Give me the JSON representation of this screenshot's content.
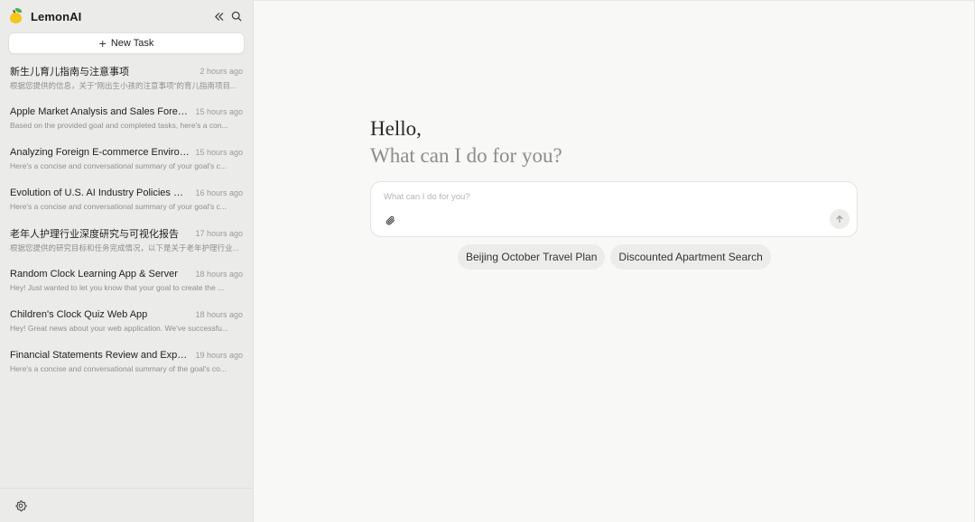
{
  "app": {
    "name": "LemonAI"
  },
  "sidebar": {
    "new_task_label": "New Task",
    "tasks": [
      {
        "title": "新生儿育儿指南与注意事项",
        "time": "2 hours ago",
        "preview": "根据您提供的信息，关于\"刚出生小孩的注意事项\"的育儿指南项目..."
      },
      {
        "title": "Apple Market Analysis and Sales Forecas...",
        "time": "15 hours ago",
        "preview": "Based on the provided goal and completed tasks, here's a con..."
      },
      {
        "title": "Analyzing Foreign E-commerce Environ...",
        "time": "15 hours ago",
        "preview": "Here's a concise and conversational summary of your goal's c..."
      },
      {
        "title": "Evolution of U.S. AI Industry Policies Ove...",
        "time": "16 hours ago",
        "preview": "Here's a concise and conversational summary of your goal's c..."
      },
      {
        "title": "老年人护理行业深度研究与可视化报告",
        "time": "17 hours ago",
        "preview": "根据您提供的研究目标和任务完成情况，以下是关于老年护理行业..."
      },
      {
        "title": "Random Clock Learning App & Server",
        "time": "18 hours ago",
        "preview": "Hey! Just wanted to let you know that your goal to create the ..."
      },
      {
        "title": "Children's Clock Quiz Web App",
        "time": "18 hours ago",
        "preview": "Hey! Great news about your web application. We've successfu..."
      },
      {
        "title": "Financial Statements Review and Expens...",
        "time": "19 hours ago",
        "preview": "Here's a concise and conversational summary of the goal's co..."
      }
    ]
  },
  "main": {
    "greeting_line1": "Hello,",
    "greeting_line2": "What can I do for you?",
    "input_placeholder": "What can I do for you?",
    "suggestions": [
      "Beijing October Travel Plan",
      "Discounted Apartment Search"
    ]
  },
  "icons": {
    "logo": "lemon-logo-icon",
    "collapse": "double-chevron-left-icon",
    "search": "search-icon",
    "new_task": "plus-icon",
    "attach": "paperclip-icon",
    "send": "arrow-up-icon",
    "settings": "gear-icon"
  },
  "colors": {
    "sidebar_bg": "#ebebea",
    "main_bg": "#f8f8f7",
    "logo_lemon": "#f5c518",
    "logo_leaf": "#4caf50"
  }
}
